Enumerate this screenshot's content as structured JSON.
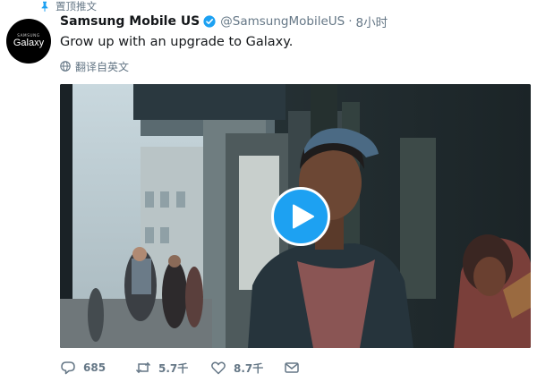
{
  "pinned": {
    "label": "置顶推文",
    "icon": "pin-icon"
  },
  "avatar": {
    "brand_top": "SAMSUNG",
    "brand_main": "Galaxy"
  },
  "tweet": {
    "display_name": "Samsung Mobile US",
    "verified": true,
    "handle": "@SamsungMobileUS",
    "separator": "·",
    "time": "8小时",
    "text": "Grow up with an upgrade to Galaxy.",
    "translate_label": "翻译自英文"
  },
  "media": {
    "type": "video",
    "play_icon": "play-icon"
  },
  "actions": {
    "reply": {
      "icon": "reply-icon",
      "count": "685"
    },
    "retweet": {
      "icon": "retweet-icon",
      "count": "5.7千"
    },
    "like": {
      "icon": "heart-icon",
      "count": "8.7千"
    },
    "message": {
      "icon": "envelope-icon"
    }
  },
  "colors": {
    "accent": "#1da1f2",
    "muted": "#657786",
    "text": "#14171a",
    "pin": "#1da1f2"
  }
}
